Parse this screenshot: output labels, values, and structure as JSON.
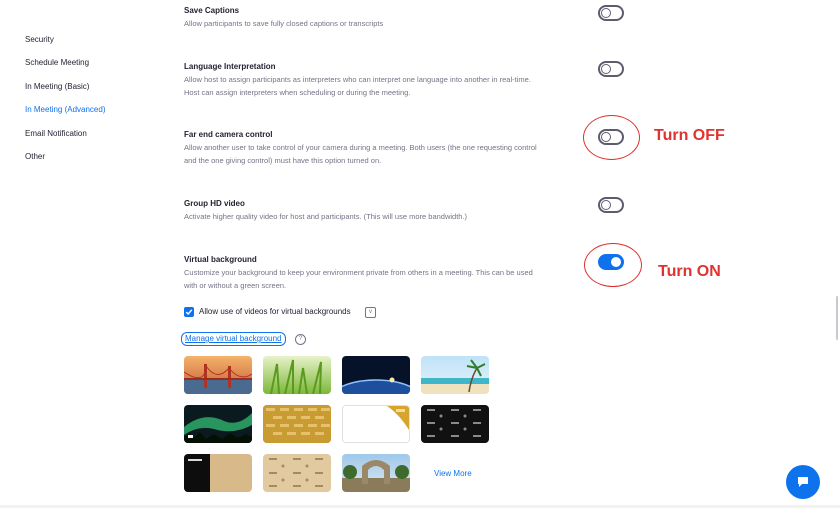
{
  "sidebar": {
    "items": [
      {
        "label": "Security",
        "active": false
      },
      {
        "label": "Schedule Meeting",
        "active": false
      },
      {
        "label": "In Meeting (Basic)",
        "active": false
      },
      {
        "label": "In Meeting (Advanced)",
        "active": true
      },
      {
        "label": "Email Notification",
        "active": false
      },
      {
        "label": "Other",
        "active": false
      }
    ]
  },
  "settings": {
    "save_captions": {
      "title": "Save Captions",
      "desc": "Allow participants to save fully closed captions or transcripts",
      "enabled": false
    },
    "language_interpretation": {
      "title": "Language Interpretation",
      "desc1": "Allow host to assign participants as interpreters who can interpret one language into another in real-time.",
      "desc2": "Host can assign interpreters when scheduling or during the meeting.",
      "enabled": false
    },
    "far_end_camera": {
      "title": "Far end camera control",
      "desc1": "Allow another user to take control of your camera during a meeting. Both users (the one requesting control",
      "desc2": "and the one giving control) must have this option turned on.",
      "enabled": false
    },
    "group_hd_video": {
      "title": "Group HD video",
      "desc": "Activate higher quality video for host and participants. (This will use more bandwidth.)",
      "enabled": false
    },
    "virtual_background": {
      "title": "Virtual background",
      "desc1": "Customize your background to keep your environment private from others in a meeting. This can be used",
      "desc2": "with or without a green screen.",
      "enabled": true,
      "allow_videos_label": "Allow use of videos for virtual backgrounds",
      "allow_videos_checked": true,
      "manage_link": "Manage virtual background",
      "view_more": "View More"
    }
  },
  "annotations": {
    "turn_off": "Turn OFF",
    "turn_on": "Turn ON"
  },
  "colors": {
    "accent": "#0e72ed",
    "annotation": "#e0322e"
  },
  "icons": {
    "info": "info-icon",
    "help": "help-circle-icon",
    "chat": "chat-bubble-icon",
    "check": "checkmark-icon"
  },
  "thumbnails": [
    {
      "name": "golden-gate-bridge"
    },
    {
      "name": "green-grass"
    },
    {
      "name": "earth-from-space"
    },
    {
      "name": "beach-palm-tree"
    },
    {
      "name": "aurora-night"
    },
    {
      "name": "gold-pattern-logos"
    },
    {
      "name": "white-gold-corner"
    },
    {
      "name": "black-logo-pattern"
    },
    {
      "name": "black-tan-split"
    },
    {
      "name": "tan-logo-pattern"
    },
    {
      "name": "campus-arch"
    }
  ]
}
